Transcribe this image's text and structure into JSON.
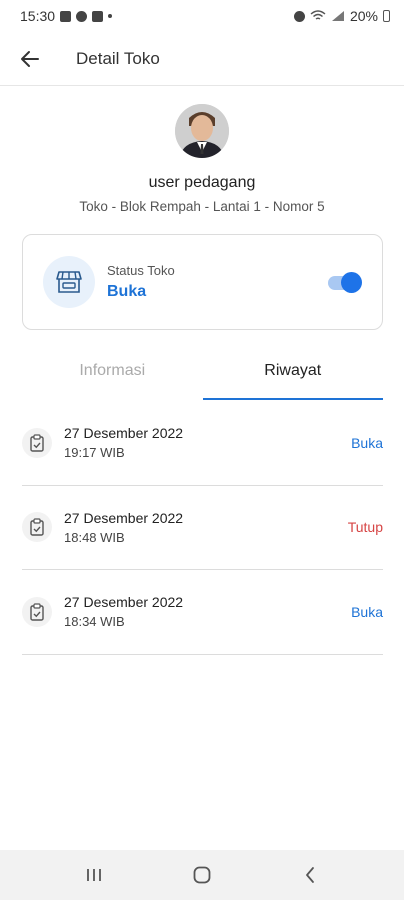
{
  "status_bar": {
    "time": "15:30",
    "battery": "20%"
  },
  "app_bar": {
    "title": "Detail Toko"
  },
  "profile": {
    "name": "user pedagang",
    "location": "Toko - Blok Rempah - Lantai 1 - Nomor 5"
  },
  "store_status": {
    "label": "Status Toko",
    "value": "Buka",
    "toggle_on": true
  },
  "tabs": [
    {
      "label": "Informasi",
      "active": false
    },
    {
      "label": "Riwayat",
      "active": true
    }
  ],
  "history": [
    {
      "date": "27 Desember 2022",
      "time": "19:17 WIB",
      "status": "Buka",
      "status_color": "#1e73d6"
    },
    {
      "date": "27 Desember 2022",
      "time": "18:48 WIB",
      "status": "Tutup",
      "status_color": "#d64545"
    },
    {
      "date": "27 Desember 2022",
      "time": "18:34 WIB",
      "status": "Buka",
      "status_color": "#1e73d6"
    }
  ],
  "colors": {
    "accent": "#1e73d6",
    "closed": "#d64545"
  }
}
